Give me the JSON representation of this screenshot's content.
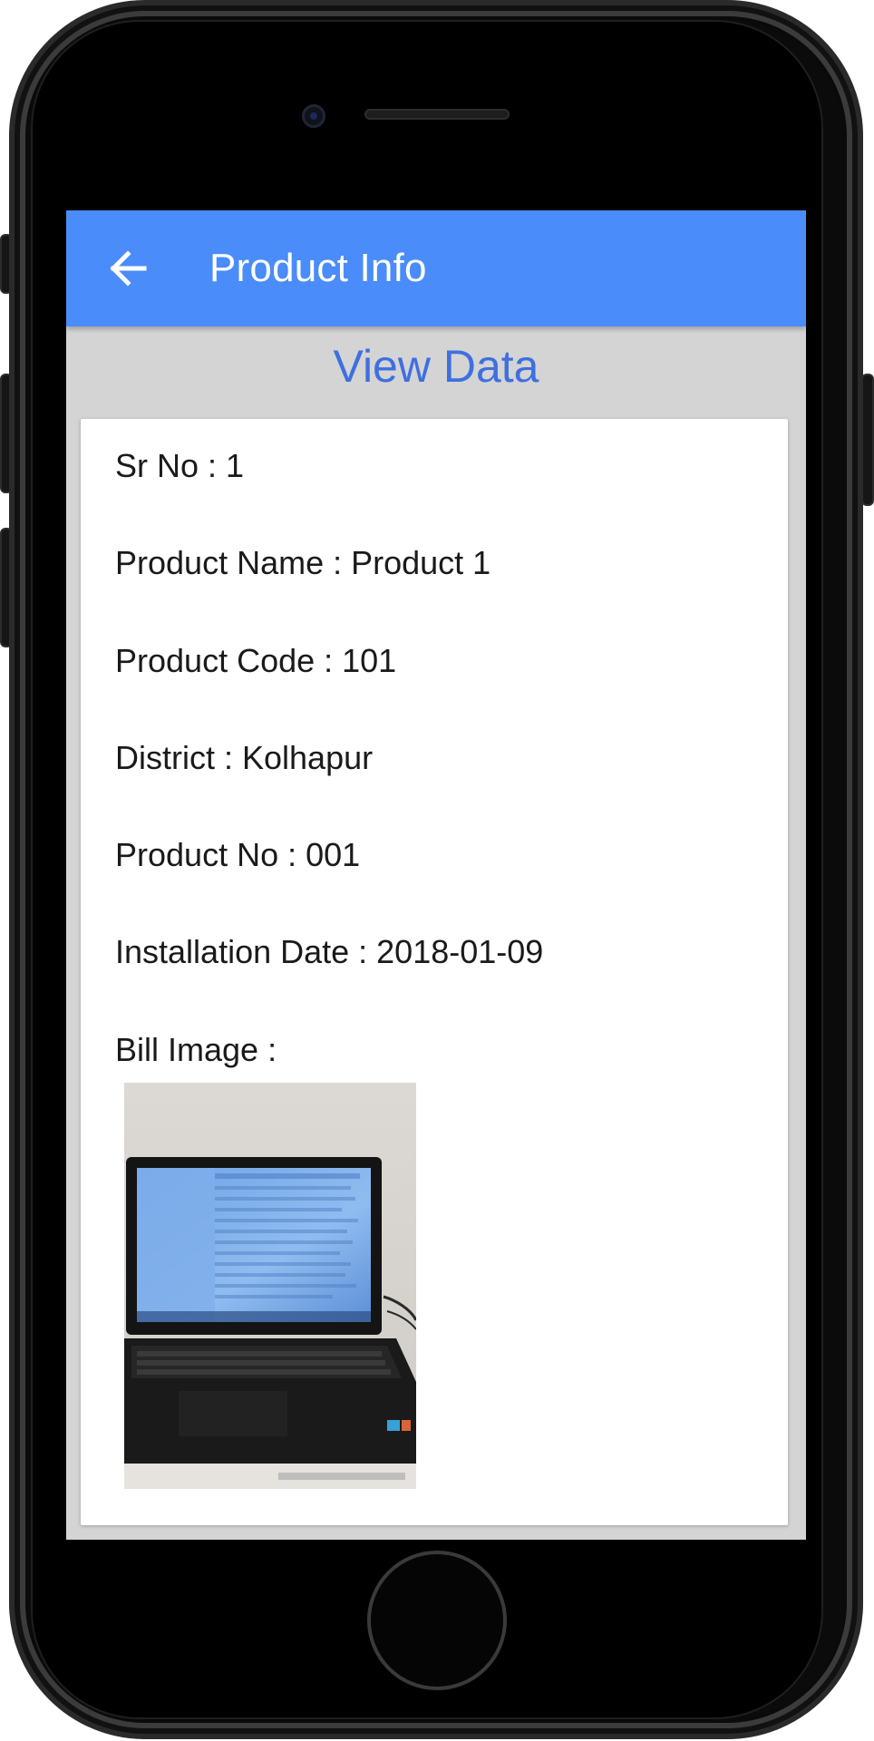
{
  "app_bar": {
    "back_icon": "arrow-left-icon",
    "title": "Product Info"
  },
  "page": {
    "heading": "View Data"
  },
  "fields": [
    {
      "label": "Sr No",
      "value": "1",
      "text": "Sr No : 1"
    },
    {
      "label": "Product Name",
      "value": "Product 1",
      "text": "Product Name : Product 1"
    },
    {
      "label": "Product Code",
      "value": "101",
      "text": "Product Code : 101"
    },
    {
      "label": "District",
      "value": "Kolhapur",
      "text": "District : Kolhapur"
    },
    {
      "label": "Product No",
      "value": "001",
      "text": "Product No : 001"
    },
    {
      "label": "Installation Date",
      "value": "2018-01-09",
      "text": "Installation Date : 2018-01-09"
    }
  ],
  "bill_image": {
    "label": "Bill Image :",
    "subject": "laptop-photo"
  },
  "colors": {
    "app_bar": "#4a8cf9",
    "heading": "#3f6fe0",
    "screen_bg": "#d4d4d4",
    "card_bg": "#ffffff"
  }
}
